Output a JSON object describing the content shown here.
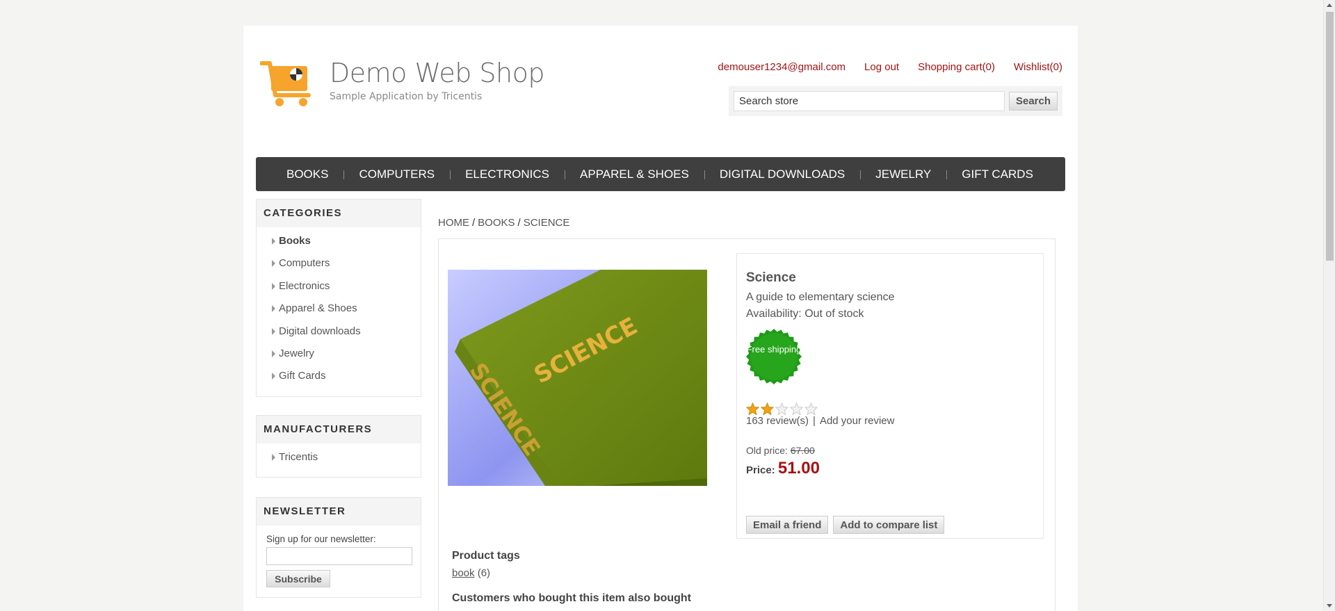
{
  "header": {
    "logo_title": "Demo Web Shop",
    "logo_subtitle": "Sample Application by Tricentis",
    "account_email": "demouser1234@gmail.com",
    "logout": "Log out",
    "shopping_cart": "Shopping cart(0)",
    "wishlist": "Wishlist(0)",
    "search_value": "Search store",
    "search_button": "Search"
  },
  "top_menu": [
    "BOOKS",
    "COMPUTERS",
    "ELECTRONICS",
    "APPAREL & SHOES",
    "DIGITAL DOWNLOADS",
    "JEWELRY",
    "GIFT CARDS"
  ],
  "categories": {
    "title": "CATEGORIES",
    "items": [
      "Books",
      "Computers",
      "Electronics",
      "Apparel & Shoes",
      "Digital downloads",
      "Jewelry",
      "Gift Cards"
    ],
    "active": "Books"
  },
  "manufacturers": {
    "title": "MANUFACTURERS",
    "items": [
      "Tricentis"
    ]
  },
  "newsletter": {
    "title": "NEWSLETTER",
    "label": "Sign up for our newsletter:",
    "button": "Subscribe"
  },
  "breadcrumb": [
    "HOME",
    "BOOKS",
    "SCIENCE"
  ],
  "product": {
    "image_text": "SCIENCE",
    "name": "Science",
    "description": "A guide to elementary science",
    "availability": "Availability: Out of stock",
    "badge": "Free shipping",
    "rating": 2,
    "rating_max": 5,
    "reviews": "163 review(s)",
    "add_review": "Add your review",
    "old_price_label": "Old price:",
    "old_price": "67.00",
    "price_label": "Price:",
    "price": "51.00",
    "email_friend": "Email a friend",
    "compare": "Add to compare list",
    "tags_title": "Product tags",
    "tag": "book",
    "tag_count": "(6)",
    "also_bought_title": "Customers who bought this item also bought"
  },
  "colors": {
    "link_red": "#a51212",
    "menu_bg": "#3f3f3f",
    "badge_green": "#1f9a16",
    "star_gold": "#f2a30f"
  }
}
